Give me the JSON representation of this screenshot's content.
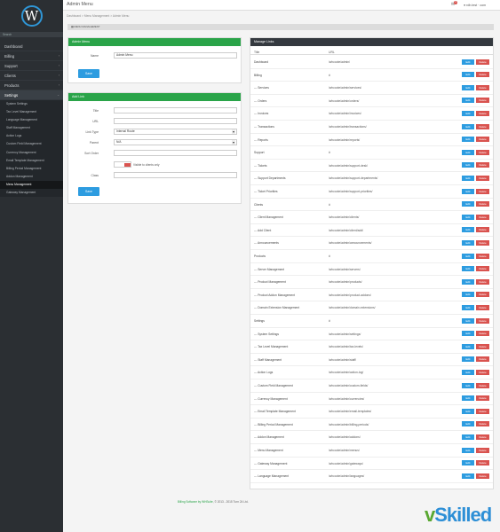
{
  "sidebar": {
    "logo_letter": "W",
    "search_placeholder": "Search",
    "items": [
      {
        "label": "Dashboard",
        "arrow": ""
      },
      {
        "label": "Billing",
        "arrow": "‹"
      },
      {
        "label": "Support",
        "arrow": "‹"
      },
      {
        "label": "Clients",
        "arrow": "‹"
      },
      {
        "label": "Products",
        "arrow": "‹"
      },
      {
        "label": "Settings",
        "arrow": "⌄"
      }
    ],
    "sub_items": [
      "System Settings",
      "Tax Level Management",
      "Language Management",
      "Staff Management",
      "Action Logs",
      "Custom Field Management",
      "Currency Management",
      "Email Template Management",
      "Billing Period Management",
      "Addon Management",
      "Menu Management",
      "Gateway Management"
    ]
  },
  "topbar": {
    "title": "Admin Menu",
    "bell_count": "3",
    "user": "rdh.test · com"
  },
  "breadcrumb": "Dashboard > Menu Management > Admin Menu",
  "notice": "MENU MANAGEMENT",
  "admin_menu_panel": {
    "title": "Admin Menu",
    "name_label": "Name",
    "name_value": "Admin Menu",
    "save_label": "Save"
  },
  "add_link_panel": {
    "title": "Add Link",
    "title_label": "Title",
    "url_label": "URL",
    "link_type_label": "Link Type",
    "link_type_value": "Internal Route",
    "parent_label": "Parent",
    "parent_value": "N/A",
    "sort_label": "Sort Order",
    "visible_text": "Visible to clients only",
    "class_label": "Class",
    "save_label": "Save"
  },
  "manage_links": {
    "title": "Manage Links",
    "col_title": "Title",
    "col_url": "URL",
    "edit_label": "Edit",
    "delete_label": "Delete",
    "rows": [
      {
        "title": "Dashboard",
        "url": "/whcoote/admin/"
      },
      {
        "title": "Billing",
        "url": "#"
      },
      {
        "title": "--- Services",
        "url": "/whcoote/admin/services/"
      },
      {
        "title": "--- Orders",
        "url": "/whcoote/admin/orders/"
      },
      {
        "title": "--- Invoices",
        "url": "/whcoote/admin/invoices/"
      },
      {
        "title": "--- Transactions",
        "url": "/whcoote/admin/transactions/"
      },
      {
        "title": "--- Reports",
        "url": "/whcoote/admin/reports/"
      },
      {
        "title": "Support",
        "url": "#"
      },
      {
        "title": "--- Tickets",
        "url": "/whcoote/admin/support-desk/"
      },
      {
        "title": "--- Support Departments",
        "url": "/whcoote/admin/support-departments/"
      },
      {
        "title": "--- Ticket Priorities",
        "url": "/whcoote/admin/support-priorities/"
      },
      {
        "title": "Clients",
        "url": "#"
      },
      {
        "title": "--- Client Management",
        "url": "/whcoote/admin/clients/"
      },
      {
        "title": "--- Add Client",
        "url": "/whcoote/admin/client/add/"
      },
      {
        "title": "--- Announcements",
        "url": "/whcoote/admin/announcements/"
      },
      {
        "title": "Products",
        "url": "#"
      },
      {
        "title": "--- Server Management",
        "url": "/whcoote/admin/servers/"
      },
      {
        "title": "--- Product Management",
        "url": "/whcoote/admin/products/"
      },
      {
        "title": "--- Product Addon Management",
        "url": "/whcoote/admin/product-addons/"
      },
      {
        "title": "--- Domain Extension Management",
        "url": "/whcoote/admin/domain-extensions/"
      },
      {
        "title": "Settings",
        "url": "#"
      },
      {
        "title": "--- System Settings",
        "url": "/whcoote/admin/settings/"
      },
      {
        "title": "--- Tax Level Management",
        "url": "/whcoote/admin/tax-levels/"
      },
      {
        "title": "--- Staff Management",
        "url": "/whcoote/admin/staff/"
      },
      {
        "title": "--- Action Logs",
        "url": "/whcoote/admin/action-log/"
      },
      {
        "title": "--- Custom Field Management",
        "url": "/whcoote/admin/custom-fields/"
      },
      {
        "title": "--- Currency Management",
        "url": "/whcoote/admin/currencies/"
      },
      {
        "title": "--- Email Template Management",
        "url": "/whcoote/admin/email-templates/"
      },
      {
        "title": "--- Billing Period Management",
        "url": "/whcoote/admin/billing-periods/"
      },
      {
        "title": "--- Addon Management",
        "url": "/whcoote/admin/addons/"
      },
      {
        "title": "--- Menu Management",
        "url": "/whcoote/admin/menus/"
      },
      {
        "title": "--- Gateway Management",
        "url": "/whcoote/admin/gateways/"
      },
      {
        "title": "--- Language Management",
        "url": "/whcoote/admin/languages/"
      }
    ]
  },
  "footer": {
    "brand": "Billing Software by WHSuite",
    "copy": ", © 2013 - 2015 Turn 24 Ltd."
  },
  "watermark": {
    "v": "v",
    "rest": "Skilled"
  }
}
